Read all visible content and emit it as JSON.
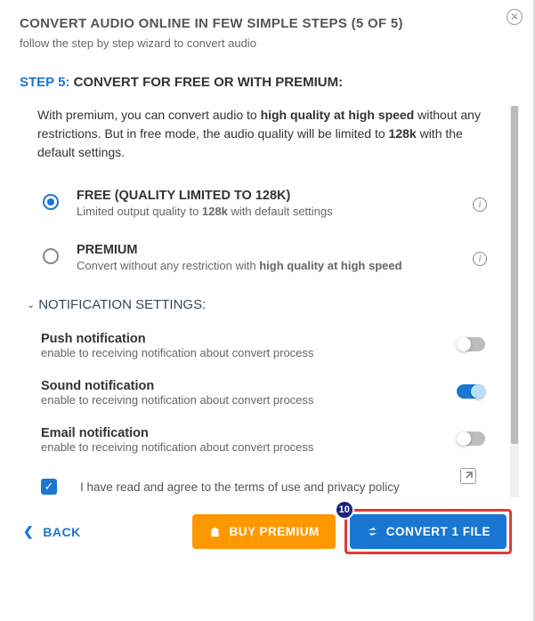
{
  "header": {
    "title": "CONVERT AUDIO ONLINE IN FEW SIMPLE STEPS (5 OF 5)",
    "subtitle": "follow the step by step wizard to convert audio"
  },
  "step": {
    "prefix": "STEP 5:",
    "label": "CONVERT FOR FREE OR WITH PREMIUM:"
  },
  "intro": {
    "pre": "With premium, you can convert audio to ",
    "b1": "high quality at high speed",
    "mid": " without any restrictions. But in free mode, the audio quality will be limited to ",
    "b2": "128k",
    "post": " with the default settings."
  },
  "options": {
    "free": {
      "title": "FREE (QUALITY LIMITED TO 128K)",
      "desc_pre": "Limited output quality to ",
      "desc_b": "128k",
      "desc_post": " with default settings"
    },
    "premium": {
      "title": "PREMIUM",
      "desc_pre": "Convert without any restriction with ",
      "desc_b": "high quality at high speed"
    }
  },
  "notif": {
    "header": "NOTIFICATION SETTINGS:",
    "push": {
      "title": "Push notification",
      "desc": "enable to receiving notification about convert process"
    },
    "sound": {
      "title": "Sound notification",
      "desc": "enable to receiving notification about convert process"
    },
    "email": {
      "title": "Email notification",
      "desc": "enable to receiving notification about convert process"
    }
  },
  "terms": {
    "text": "I have read and agree to the terms of use and privacy policy"
  },
  "footer": {
    "back": "BACK",
    "buy": "BUY PREMIUM",
    "convert": "CONVERT 1 FILE",
    "badge": "10"
  }
}
